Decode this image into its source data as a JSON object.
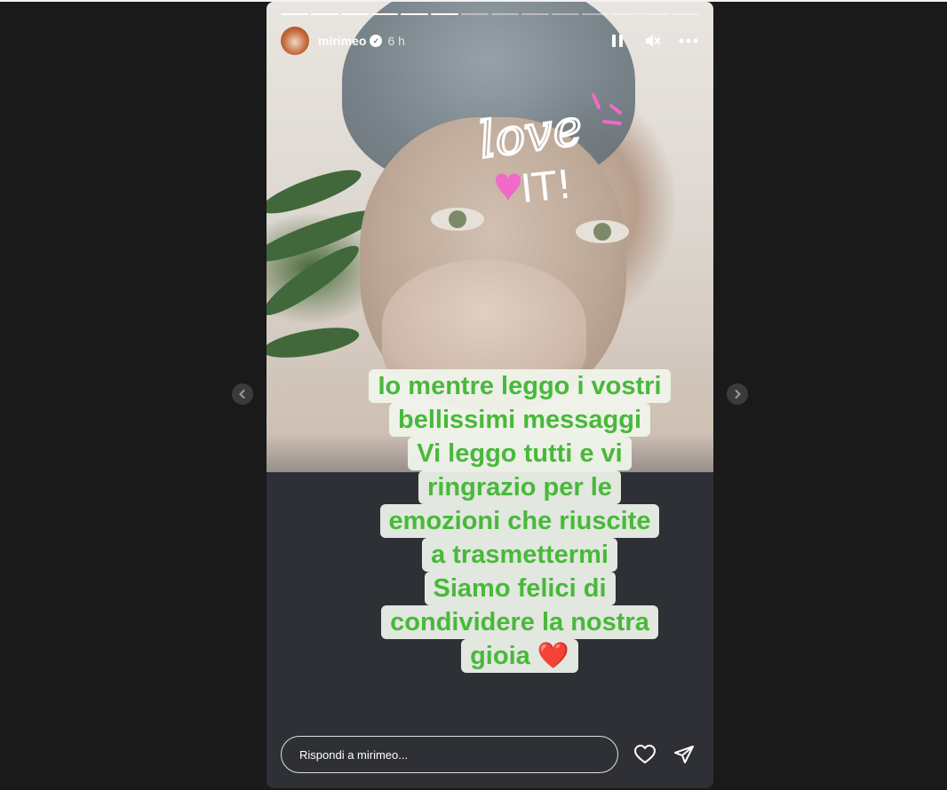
{
  "story": {
    "username": "mirimeo",
    "time": "6 h",
    "progress_total": 14,
    "progress_current": 6,
    "verified_icon": "verified-badge-icon",
    "controls": [
      "pause-icon",
      "mute-icon",
      "more-options-icon"
    ]
  },
  "sticker": {
    "line1": "love",
    "line2": "IT!",
    "color_text": "#ffffff",
    "color_accent": "#f06ac8"
  },
  "caption": {
    "lines": [
      "Io mentre leggo i vostri",
      "bellissimi messaggi",
      "Vi leggo tutti e vi",
      "ringrazio per le",
      "emozioni che riuscite",
      "a trasmettermi",
      "Siamo felici di",
      "condividere la nostra",
      "gioia"
    ],
    "emoji": "❤️",
    "text_color": "#48b93a"
  },
  "reply": {
    "placeholder": "Rispondi a mirimeo..."
  },
  "icons": {
    "like": "heart-icon",
    "share": "send-icon",
    "prev": "chevron-left-icon",
    "next": "chevron-right-icon"
  }
}
